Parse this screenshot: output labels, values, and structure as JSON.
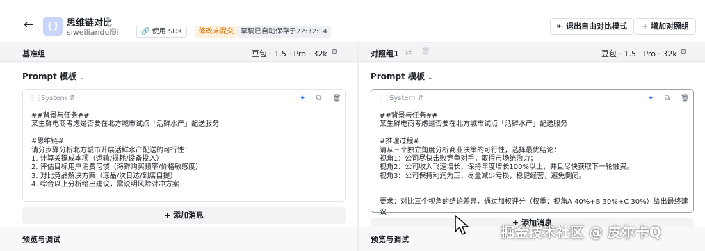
{
  "header": {
    "back_icon": "arrow-left-icon",
    "app_icon_glyph": "{}",
    "app_title": "思维链对比",
    "app_slug": "siweiliandulbi",
    "sdk_label": "使用 SDK",
    "unsaved_badge": "修改未提交",
    "saved_badge": "草稿已自动保存于22:32:14",
    "exit_label": "退出自由对比模式",
    "add_label": "+ 增加对照组"
  },
  "left_panel": {
    "name": "基准组",
    "model": "豆包 · 1.5 · Pro · 32k",
    "template_title": "Prompt 模板",
    "system_label": "System",
    "content": "##背景与任务##\n某生鲜电商考虑是否要在北方城市试点「活鲜水产」配送服务\n\n#思维链#\n请分步骤分析北方城市开展活鲜水产配送的可行性：\n1. 计算关键成本项（运输/损耗/设备投入）\n2. 评估目标用户消费习惯（海鲜购买频率/价格敏感度）\n3. 对比竞品解决方案（冻品/次日达/到店自提）\n4. 综合以上分析给出建议，需说明风险对冲方案",
    "add_message": "+ 添加消息",
    "section_title": "预览与调试"
  },
  "right_panel": {
    "name": "对照组1",
    "model": "豆包 · 1.5 · Pro · 32k",
    "template_title": "Prompt 模板",
    "system_label": "System",
    "content": "##背景与任务##\n某生鲜电商考虑是否要在北方城市试点「活鲜水产」配送服务\n\n#推理过程#\n请从三个独立角度分析商业决策的可行性，选择最优结论：\n视角1：公司尽快击败竞争对手，取得市场统治力；\n视角2：公司收入飞速增长，保持年度增长100%以上，并且尽快获取下一轮融资。\n视角3：公司保持利润为正，尽量减少亏损，稳健经营，避免倒闭。",
    "footnote": "要求：对比三个视角的结论差异，通过加权评分（权重：视角A 40%+B 30%+C 30%）给出最终建议",
    "add_message": "+ 添加消息",
    "section_title": "预览与调试"
  },
  "watermark": "掘金技术社区 @ 皮尔卡Q",
  "colors": {
    "accent": "#3370ff",
    "unsaved_bg": "#fff1de",
    "unsaved_fg": "#d26b00",
    "app_icon_bg": "#c9d4fb"
  }
}
